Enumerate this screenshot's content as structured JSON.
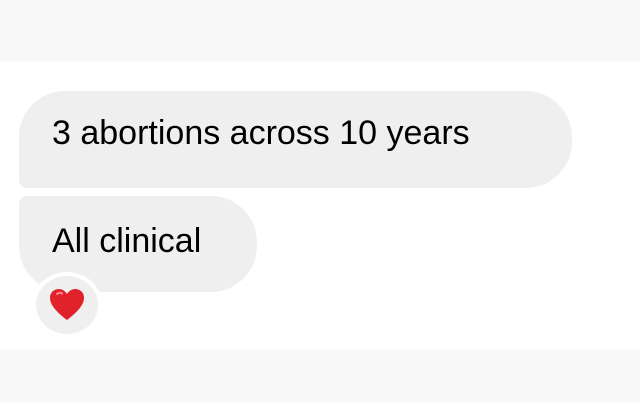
{
  "messages": [
    {
      "text": "3 abortions across 10 years"
    },
    {
      "text": "All clinical"
    }
  ],
  "reaction": {
    "icon": "red-heart-icon",
    "color": "#e0222b"
  },
  "colors": {
    "bubble_bg": "#efeff0",
    "chat_bg": "#ffffff",
    "page_bg": "#f9f9f9"
  }
}
